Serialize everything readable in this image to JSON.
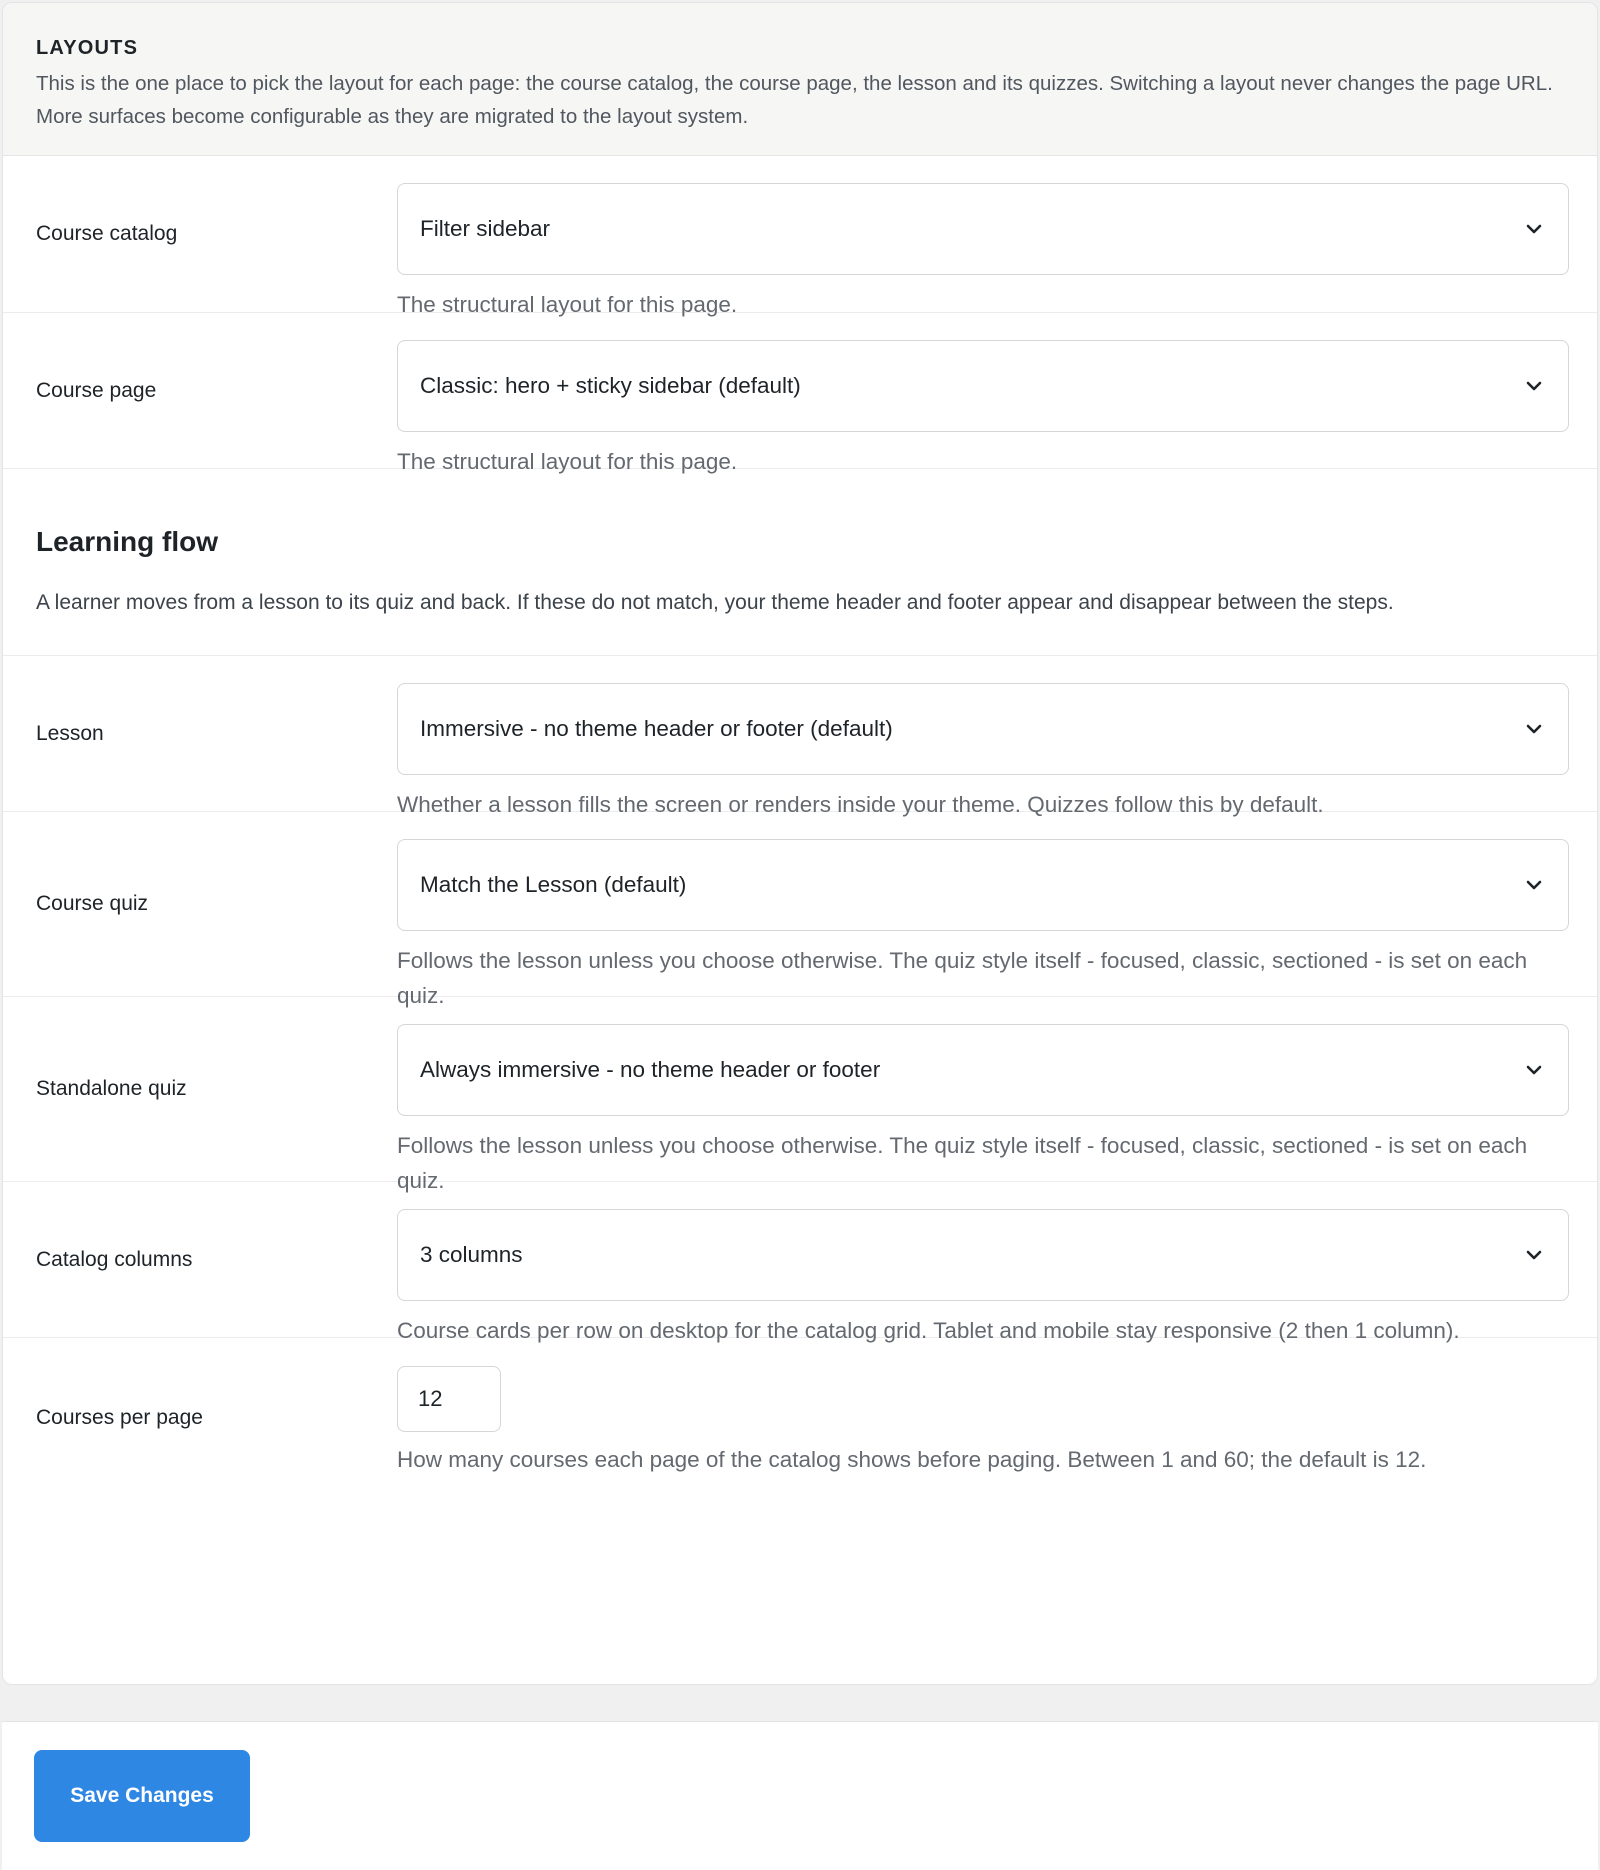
{
  "header": {
    "title": "LAYOUTS",
    "description": "This is the one place to pick the layout for each page: the course catalog, the course page, the lesson and its quizzes. Switching a layout never changes the page URL. More surfaces become configurable as they are migrated to the layout system."
  },
  "fields": {
    "course_catalog": {
      "label": "Course catalog",
      "value": "Filter sidebar",
      "help": "The structural layout for this page."
    },
    "course_page": {
      "label": "Course page",
      "value": "Classic: hero + sticky sidebar (default)",
      "help": "The structural layout for this page."
    },
    "lesson": {
      "label": "Lesson",
      "value": "Immersive - no theme header or footer (default)",
      "help": "Whether a lesson fills the screen or renders inside your theme. Quizzes follow this by default."
    },
    "course_quiz": {
      "label": "Course quiz",
      "value": "Match the Lesson (default)",
      "help": "Follows the lesson unless you choose otherwise. The quiz style itself - focused, classic, sectioned - is set on each quiz."
    },
    "standalone_quiz": {
      "label": "Standalone quiz",
      "value": "Always immersive - no theme header or footer",
      "help": "Follows the lesson unless you choose otherwise. The quiz style itself - focused, classic, sectioned - is set on each quiz."
    },
    "catalog_columns": {
      "label": "Catalog columns",
      "value": "3 columns",
      "help": "Course cards per row on desktop for the catalog grid. Tablet and mobile stay responsive (2 then 1 column)."
    },
    "courses_per_page": {
      "label": "Courses per page",
      "value": "12",
      "help": "How many courses each page of the catalog shows before paging. Between 1 and 60; the default is 12."
    }
  },
  "learning_flow": {
    "title": "Learning flow",
    "description": "A learner moves from a lesson to its quiz and back. If these do not match, your theme header and footer appear and disappear between the steps."
  },
  "footer": {
    "save_label": "Save Changes"
  },
  "icons": {
    "dropdown": "chevron-down-icon"
  },
  "colors": {
    "accent": "#2f87e4",
    "header_bg": "#f6f6f5",
    "page_bg": "#f0f0f1"
  }
}
